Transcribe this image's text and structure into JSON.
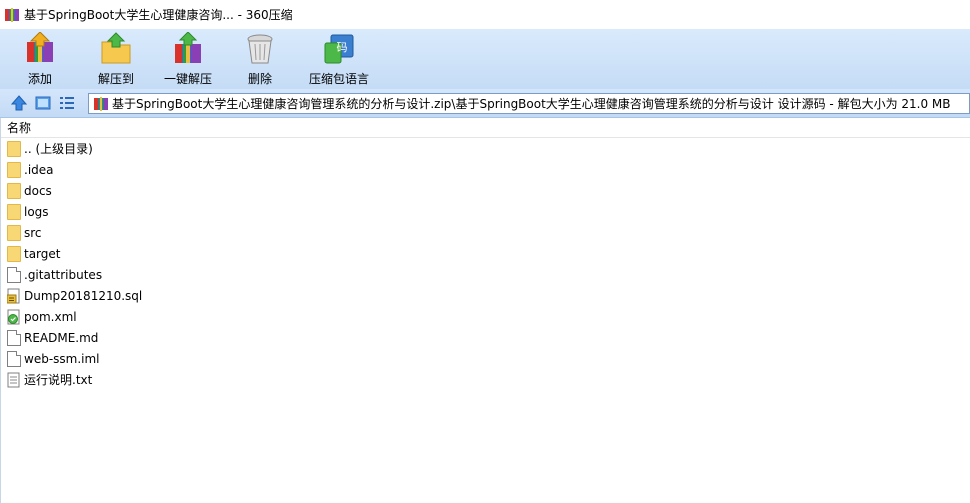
{
  "window": {
    "title": "基于SpringBoot大学生心理健康咨询... - 360压缩"
  },
  "toolbar": {
    "buttons": [
      {
        "label": "添加",
        "icon": "add-archive-icon"
      },
      {
        "label": "解压到",
        "icon": "extract-to-icon"
      },
      {
        "label": "一键解压",
        "icon": "one-click-extract-icon"
      },
      {
        "label": "删除",
        "icon": "delete-trash-icon"
      },
      {
        "label": "压缩包语言",
        "icon": "archive-language-icon"
      }
    ]
  },
  "address": {
    "path": "基于SpringBoot大学生心理健康咨询管理系统的分析与设计.zip\\基于SpringBoot大学生心理健康咨询管理系统的分析与设计 设计源码 - 解包大小为 21.0 MB"
  },
  "list": {
    "column_name": "名称",
    "items": [
      {
        "name": ".. (上级目录)",
        "type": "folder"
      },
      {
        "name": ".idea",
        "type": "folder"
      },
      {
        "name": "docs",
        "type": "folder"
      },
      {
        "name": "logs",
        "type": "folder"
      },
      {
        "name": "src",
        "type": "folder"
      },
      {
        "name": "target",
        "type": "folder"
      },
      {
        "name": ".gitattributes",
        "type": "file"
      },
      {
        "name": "Dump20181210.sql",
        "type": "sql"
      },
      {
        "name": "pom.xml",
        "type": "xml"
      },
      {
        "name": "README.md",
        "type": "file"
      },
      {
        "name": "web-ssm.iml",
        "type": "file"
      },
      {
        "name": "运行说明.txt",
        "type": "txt"
      }
    ]
  },
  "colors": {
    "toolbar_bg": "#c5dcf6",
    "folder": "#f8d775",
    "address_border": "#7a9cc6"
  }
}
